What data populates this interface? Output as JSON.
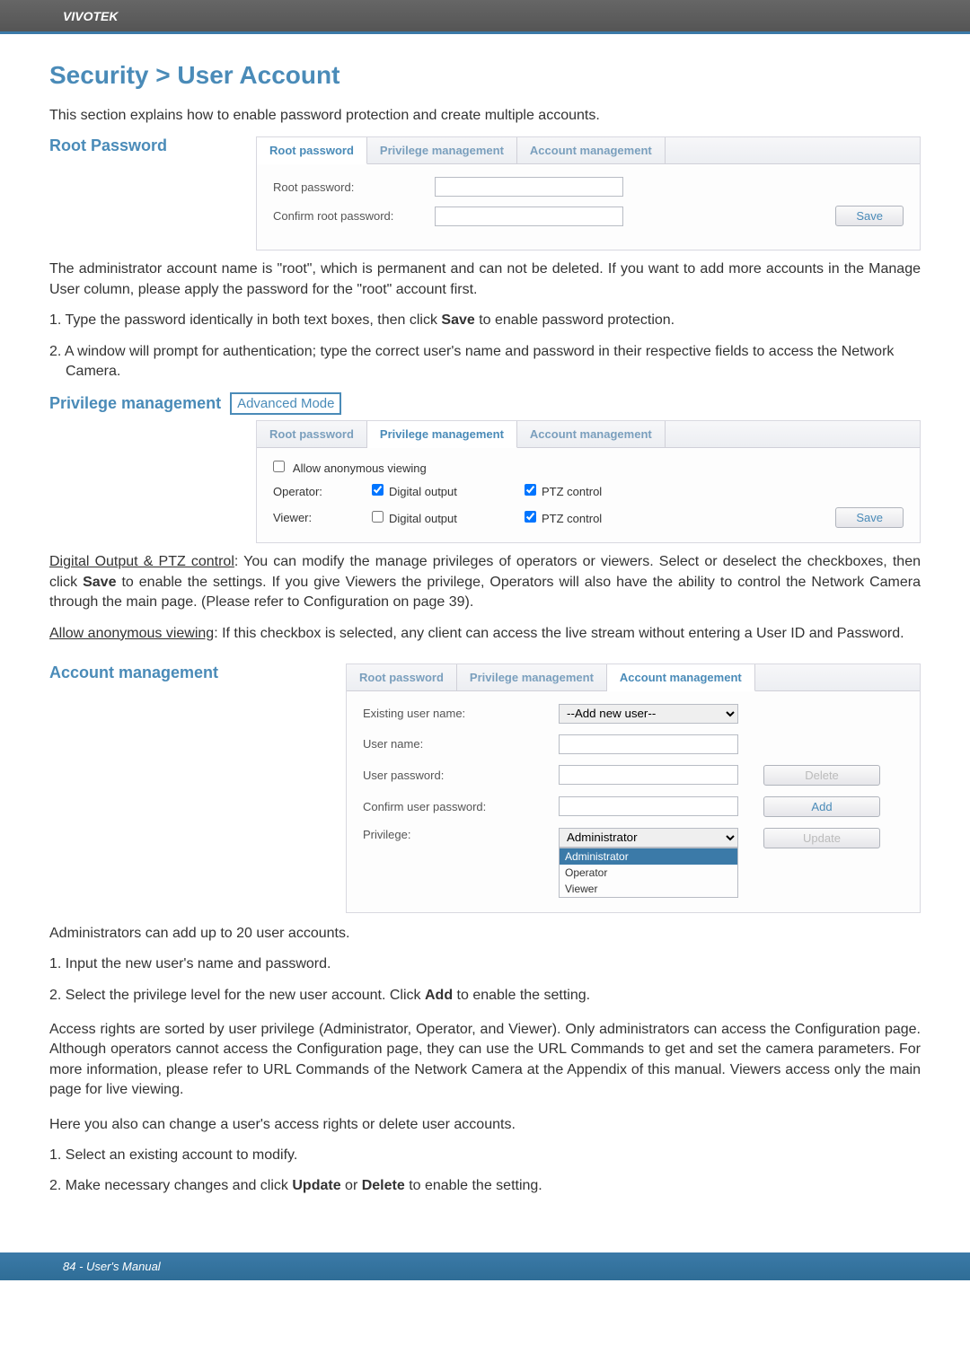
{
  "header": {
    "brand": "VIVOTEK"
  },
  "title": "Security > User Account",
  "intro": "This section explains how to enable password protection and create multiple accounts.",
  "root_password": {
    "heading": "Root Password",
    "tabs": {
      "root": "Root password",
      "priv": "Privilege management",
      "acct": "Account management"
    },
    "labels": {
      "root_pw": "Root password:",
      "confirm_pw": "Confirm root password:"
    },
    "save": "Save",
    "desc_p1": "The administrator account name is \"root\", which is permanent and can not be deleted. If you want to add more accounts in the Manage User column, please apply the password for the \"root\" account first.",
    "step1_a": "1. Type the password identically in both text boxes, then click ",
    "step1_bold": "Save",
    "step1_b": " to enable password protection.",
    "step2": "2. A window will prompt for authentication; type the correct user's name and password in their respective fields to access the Network Camera."
  },
  "priv_mgmt": {
    "heading": "Privilege management",
    "badge": "Advanced Mode",
    "allow_anon": "Allow anonymous viewing",
    "rows": {
      "operator": "Operator:",
      "viewer": "Viewer:",
      "digital_output": "Digital output",
      "ptz": "PTZ control"
    },
    "save": "Save",
    "para1_a": "Digital Output & PTZ control",
    "para1_b": ": You can modify the manage privileges of operators or viewers. Select or deselect the checkboxes, then click ",
    "para1_bold": "Save",
    "para1_c": " to enable the settings. If you give Viewers the privilege, Operators will also have the ability to control the Network Camera through the main page. (Please refer to Configuration on page 39).",
    "para2_a": "Allow anonymous viewing",
    "para2_b": ": If this checkbox is selected, any client can access the live stream without entering a User ID and Password."
  },
  "acct_mgmt": {
    "heading": "Account management",
    "labels": {
      "existing": "Existing user name:",
      "username": "User name:",
      "password": "User password:",
      "confirm": "Confirm user password:",
      "privilege": "Privilege:",
      "add_new": "--Add new user--"
    },
    "privs": {
      "admin": "Administrator",
      "admin_hl": "Administrator",
      "operator": "Operator",
      "viewer": "Viewer"
    },
    "buttons": {
      "delete": "Delete",
      "add": "Add",
      "update": "Update"
    },
    "below1": "Administrators can add up to 20 user accounts.",
    "step1": "1. Input the new user's name and password.",
    "step2_a": "2. Select the privilege level for the new user account. Click ",
    "step2_bold": "Add",
    "step2_b": " to enable the setting.",
    "para3": "Access rights are sorted by user privilege (Administrator, Operator, and Viewer). Only administrators can access the Configuration page. Although operators cannot access the Configuration page, they can use the URL Commands to get and set the camera parameters. For more information, please refer to URL Commands of the Network Camera at the Appendix of this manual. Viewers access only the main page for live viewing.",
    "para4": "Here you also can change a user's access rights or delete user accounts.",
    "step3": "1. Select an existing account to modify.",
    "step4_a": "2. Make necessary changes and click ",
    "step4_bold1": "Update",
    "step4_mid": " or ",
    "step4_bold2": "Delete",
    "step4_b": " to enable the setting."
  },
  "footer": {
    "text": "84 - User's Manual"
  }
}
